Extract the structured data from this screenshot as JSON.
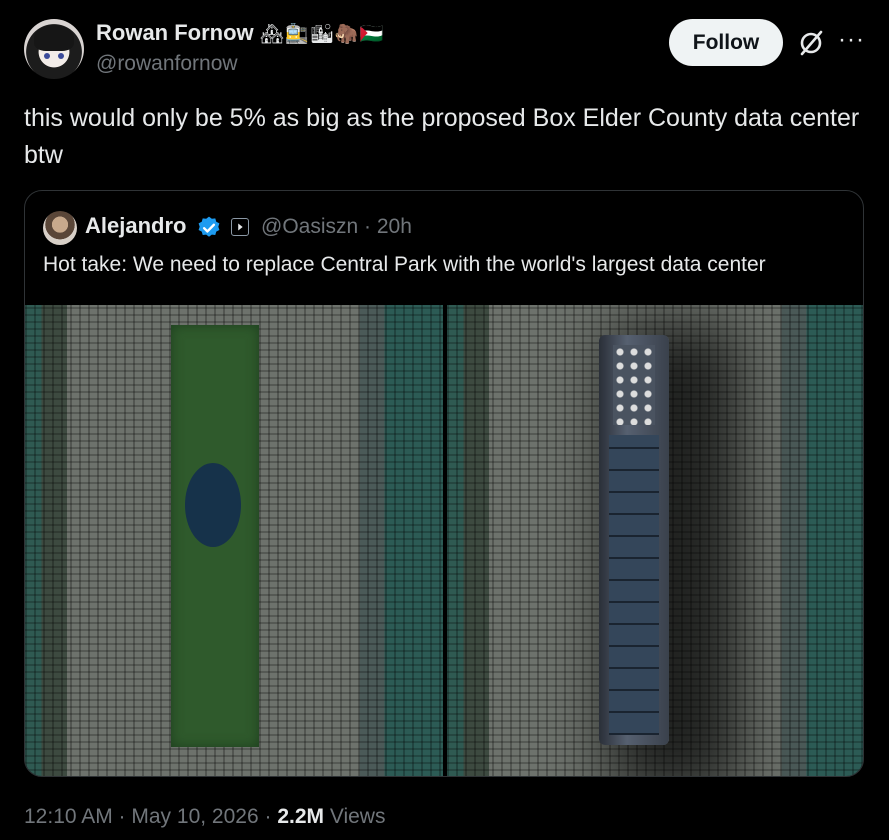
{
  "author": {
    "name": "Rowan Fornow",
    "handle": "@rowanfornow",
    "emojis": "🏘🚉🏙🦣🇵🇸"
  },
  "actions": {
    "follow_label": "Follow",
    "grok_icon": "grok-icon",
    "more_icon": "more-icon"
  },
  "tweet": {
    "text": "this would only be 5% as big as the proposed Box Elder County data center btw"
  },
  "quote": {
    "name": "Alejandro",
    "handle_time": "@Oasiszn · 20h",
    "text": "Hot take: We need to replace Central Park with the world's largest data center"
  },
  "meta": {
    "timestamp": "12:10 AM · May 10, 2026 · ",
    "views_count": "2.2M",
    "views_label": " Views"
  },
  "colors": {
    "background": "#000000",
    "text": "#e7e9ea",
    "secondary": "#71767b",
    "verified": "#1d9bf0"
  }
}
